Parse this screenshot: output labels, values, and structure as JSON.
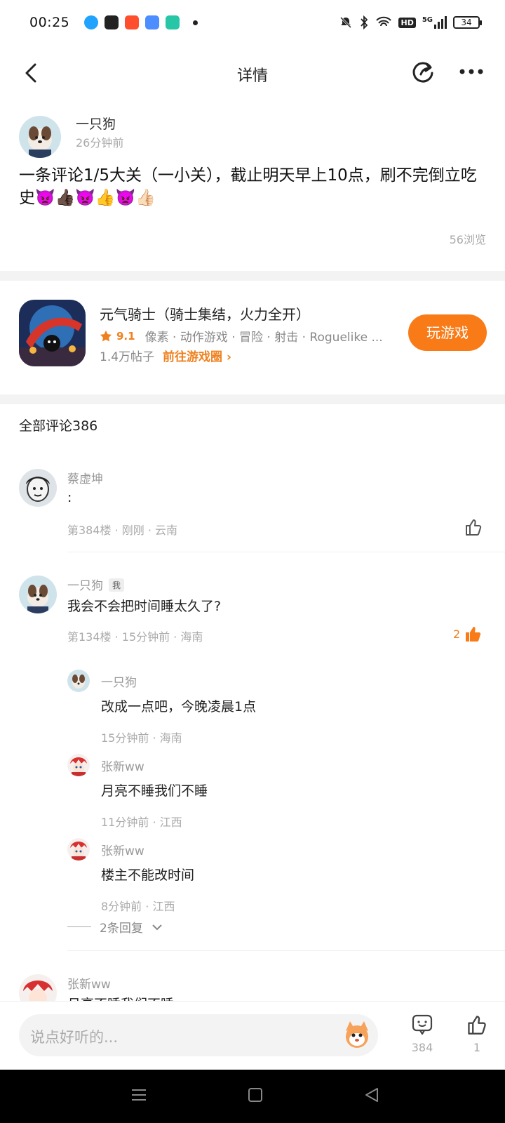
{
  "status_bar": {
    "time": "00:25",
    "battery": "34",
    "signal_label": "5G",
    "hd_label": "HD"
  },
  "header": {
    "title": "详情"
  },
  "post": {
    "author": "一只狗",
    "time": "26分钟前",
    "content": "一条评论1/5大关（一小关），截止明天早上10点，刷不完倒立吃史",
    "emojis": "👿👍🏿👿👍👿👍🏻",
    "views": "56浏览"
  },
  "game": {
    "title": "元气骑士（骑士集结，火力全开）",
    "rating": "9.1",
    "tags": "像素 · 动作游戏 · 冒险 · 射击 · Roguelike ...",
    "posts_count": "1.4万帖子",
    "circle_link": "前往游戏圈",
    "play_label": "玩游戏"
  },
  "comments_header": "全部评论386",
  "comments": [
    {
      "author": "蔡虚坤",
      "text": ":",
      "meta": "第384楼 · 刚刚 · 云南",
      "likes": ""
    },
    {
      "author": "一只狗",
      "badge": "我",
      "text": "我会不会把时间睡太久了?",
      "meta": "第134楼 · 15分钟前 · 海南",
      "likes": "2",
      "replies": [
        {
          "author": "一只狗",
          "text": "改成一点吧，今晚凌晨1点",
          "meta": "15分钟前 · 海南"
        },
        {
          "author": "张新ww",
          "text": "月亮不睡我们不睡",
          "meta": "11分钟前 · 江西"
        },
        {
          "author": "张新ww",
          "text": "楼主不能改时间",
          "meta": "8分钟前 · 江西"
        }
      ],
      "more_replies": "2条回复"
    },
    {
      "author": "张新ww",
      "text": "月亮不睡我们不睡"
    }
  ],
  "input": {
    "placeholder": "说点好听的..."
  },
  "actions": {
    "comment_count": "384",
    "like_count": "1"
  },
  "colors": {
    "accent": "#f97b17",
    "divider": "#f3f3f3"
  }
}
